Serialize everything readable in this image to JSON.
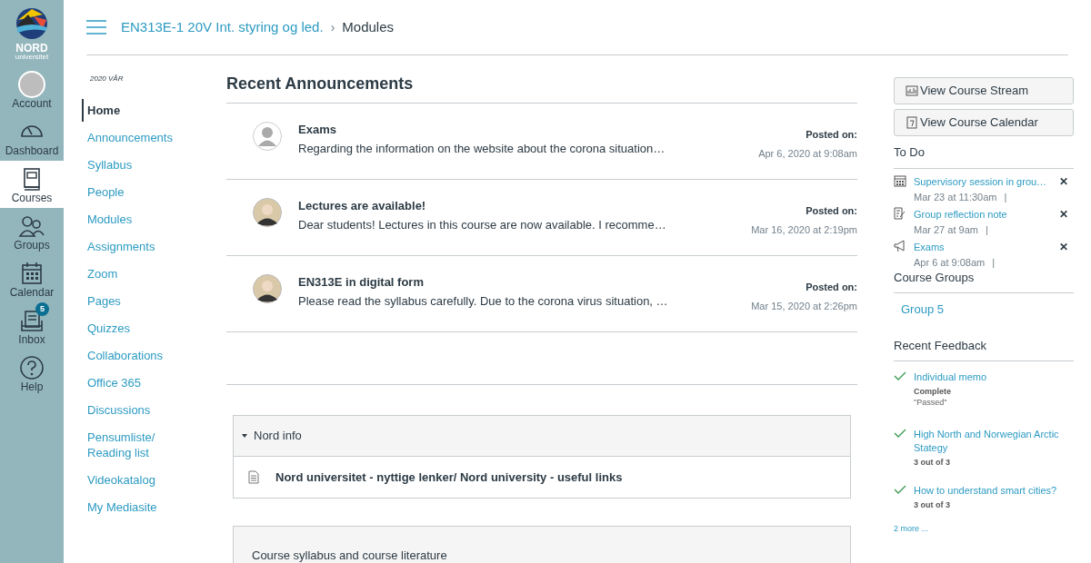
{
  "logo": {
    "name": "NORD",
    "sub": "universitet"
  },
  "global_nav": [
    {
      "kind": "account",
      "label": "Account",
      "selected": false
    },
    {
      "kind": "dashboard",
      "label": "Dashboard",
      "selected": false
    },
    {
      "kind": "courses",
      "label": "Courses",
      "selected": true
    },
    {
      "kind": "groups",
      "label": "Groups",
      "selected": false
    },
    {
      "kind": "calendar",
      "label": "Calendar",
      "selected": false
    },
    {
      "kind": "inbox",
      "label": "Inbox",
      "selected": false,
      "badge": "5"
    },
    {
      "kind": "help",
      "label": "Help",
      "selected": false
    }
  ],
  "breadcrumb": {
    "course": "EN313E-1 20V Int. styring og led.",
    "separator": "›",
    "page": "Modules"
  },
  "course_nav": {
    "term": "2020 VÅR",
    "items": [
      {
        "label": "Home",
        "selected": true
      },
      {
        "label": "Announcements",
        "selected": false
      },
      {
        "label": "Syllabus",
        "selected": false
      },
      {
        "label": "People",
        "selected": false
      },
      {
        "label": "Modules",
        "selected": false
      },
      {
        "label": "Assignments",
        "selected": false
      },
      {
        "label": "Zoom",
        "selected": false
      },
      {
        "label": "Pages",
        "selected": false
      },
      {
        "label": "Quizzes",
        "selected": false
      },
      {
        "label": "Collaborations",
        "selected": false
      },
      {
        "label": "Office 365",
        "selected": false
      },
      {
        "label": "Discussions",
        "selected": false
      },
      {
        "label": "Pensumliste/ Reading list",
        "selected": false
      },
      {
        "label": "Videokatalog",
        "selected": false
      },
      {
        "label": "My Mediasite",
        "selected": false
      }
    ]
  },
  "announcements": {
    "title": "Recent Announcements",
    "items": [
      {
        "kind": "default",
        "title": "Exams",
        "excerpt": "Regarding the information on the website about the corona situation…",
        "posted_label": "Posted on:",
        "date": "Apr 6, 2020 at 9:08am"
      },
      {
        "kind": "photo",
        "title": "Lectures are available!",
        "excerpt": "Dear students!  Lectures in this course are now available. I recomme…",
        "posted_label": "Posted on:",
        "date": "Mar 16, 2020 at 2:19pm"
      },
      {
        "kind": "photo",
        "title": "EN313E in digital form",
        "excerpt": "Please read the syllabus carefully. Due to the corona virus situation, …",
        "posted_label": "Posted on:",
        "date": "Mar 15, 2020 at 2:26pm"
      }
    ]
  },
  "modules": [
    {
      "title": "Nord info",
      "expanded": true,
      "items": [
        "Nord universitet - nyttige lenker/ Nord university - useful links"
      ]
    },
    {
      "title": "Course syllabus and course literature"
    }
  ],
  "sidebar": {
    "buttons": [
      {
        "kind": "stream",
        "label": "View Course Stream"
      },
      {
        "kind": "calendar",
        "label": "View Course Calendar"
      }
    ],
    "todo_title": "To Do",
    "todo": [
      {
        "kind": "event",
        "title": "Supervisory session in grou…",
        "date": "Mar 23 at 11:30am",
        "separator": "|",
        "dismiss": "✕"
      },
      {
        "kind": "assignment",
        "title": "Group reflection note",
        "date": "Mar 27 at 9am",
        "separator": "|",
        "dismiss": "✕"
      },
      {
        "kind": "announcement",
        "title": "Exams",
        "date": "Apr 6 at 9:08am",
        "separator": "|",
        "dismiss": "✕"
      }
    ],
    "groups_title": "Course Groups",
    "groups": [
      "Group 5"
    ],
    "feedback_title": "Recent Feedback",
    "feedback": [
      {
        "title": "Individual memo",
        "status": "Complete",
        "comment": "\"Passed\""
      },
      {
        "title": "High North and Norwegian Arctic Stategy",
        "status": "3 out of 3"
      },
      {
        "title": "How to understand smart cities?",
        "status": "3 out of 3"
      }
    ],
    "more": "2 more ..."
  }
}
